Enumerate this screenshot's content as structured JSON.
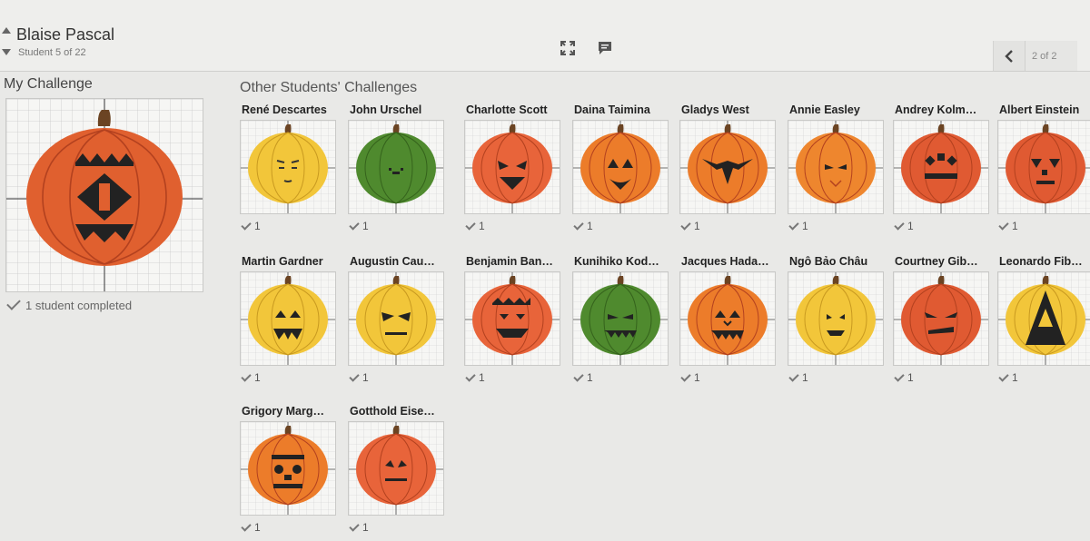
{
  "header": {
    "student_name": "Blaise Pascal",
    "student_count": "Student 5 of 22",
    "page_label": "2 of 2",
    "icons": [
      "chevron-up-icon",
      "chevron-down-icon",
      "fullscreen-icon",
      "comment-icon",
      "chevron-left-icon"
    ]
  },
  "my_challenge": {
    "title": "My Challenge",
    "completed": "1 student completed",
    "pumpkin_color": "#e0602f"
  },
  "others": {
    "title": "Other Students' Challenges",
    "students": [
      {
        "name": "René Descartes",
        "count": "1",
        "color": "#f2c63a",
        "face": "sleepy"
      },
      {
        "name": "John Urschel",
        "count": "1",
        "color": "#4f8a2e",
        "face": "mouth"
      },
      {
        "name": "Charlotte Scott",
        "count": "1",
        "color": "#e8643a",
        "face": "angry"
      },
      {
        "name": "Daina Taimina",
        "count": "1",
        "color": "#ec7c2a",
        "face": "classic"
      },
      {
        "name": "Gladys West",
        "count": "1",
        "color": "#ec7c2a",
        "face": "bat"
      },
      {
        "name": "Annie Easley",
        "count": "1",
        "color": "#ee862e",
        "face": "calm"
      },
      {
        "name": "Andrey Kolm…",
        "count": "1",
        "color": "#e05a32",
        "face": "shapes"
      },
      {
        "name": "Albert Einstein",
        "count": "1",
        "color": "#e05a32",
        "face": "triangles"
      },
      {
        "name": "Martin Gardner",
        "count": "1",
        "color": "#f2c63a",
        "face": "fangs"
      },
      {
        "name": "Augustin Cau…",
        "count": "1",
        "color": "#f2c63a",
        "face": "stern"
      },
      {
        "name": "Benjamin Ban…",
        "count": "1",
        "color": "#e8643a",
        "face": "zigzag"
      },
      {
        "name": "Kunihiko Kod…",
        "count": "1",
        "color": "#4f8a2e",
        "face": "grin"
      },
      {
        "name": "Jacques Hada…",
        "count": "1",
        "color": "#ec7c2a",
        "face": "teeth"
      },
      {
        "name": "Ngô Bảo Châu",
        "count": "1",
        "color": "#f2c63a",
        "face": "small"
      },
      {
        "name": "Courtney Gib…",
        "count": "1",
        "color": "#e05a32",
        "face": "slant"
      },
      {
        "name": "Leonardo Fib…",
        "count": "1",
        "color": "#f2c63a",
        "face": "pyramid"
      },
      {
        "name": "Grigory Marg…",
        "count": "1",
        "color": "#ec7c2a",
        "face": "robot"
      },
      {
        "name": "Gotthold Eise…",
        "count": "1",
        "color": "#e8643a",
        "face": "simple"
      }
    ]
  }
}
